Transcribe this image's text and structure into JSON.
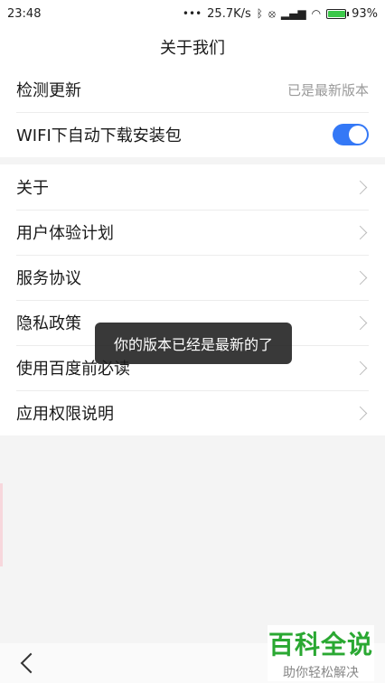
{
  "status_bar": {
    "time": "23:48",
    "net_speed": "25.7K/s",
    "battery_percent": "93%",
    "icons": [
      "dots-icon",
      "bluetooth-icon",
      "vibrate-icon",
      "signal-icon",
      "wifi-icon",
      "battery-icon"
    ],
    "battery_level": 0.93
  },
  "header": {
    "title": "关于我们"
  },
  "settings": {
    "update_label": "检测更新",
    "update_value": "已是最新版本",
    "wifi_label": "WIFI下自动下载安装包",
    "wifi_toggle_on": true
  },
  "menu": {
    "items": [
      {
        "label": "关于"
      },
      {
        "label": "用户体验计划"
      },
      {
        "label": "服务协议"
      },
      {
        "label": "隐私政策"
      },
      {
        "label": "使用百度前必读"
      },
      {
        "label": "应用权限说明"
      }
    ]
  },
  "toast": {
    "message": "你的版本已经是最新的了"
  },
  "watermark": {
    "main": "百科全说",
    "sub": "助你轻松解决"
  },
  "colors": {
    "accent": "#3478f6",
    "watermark": "#2aa832",
    "toast_bg": "#1e1e1e"
  }
}
